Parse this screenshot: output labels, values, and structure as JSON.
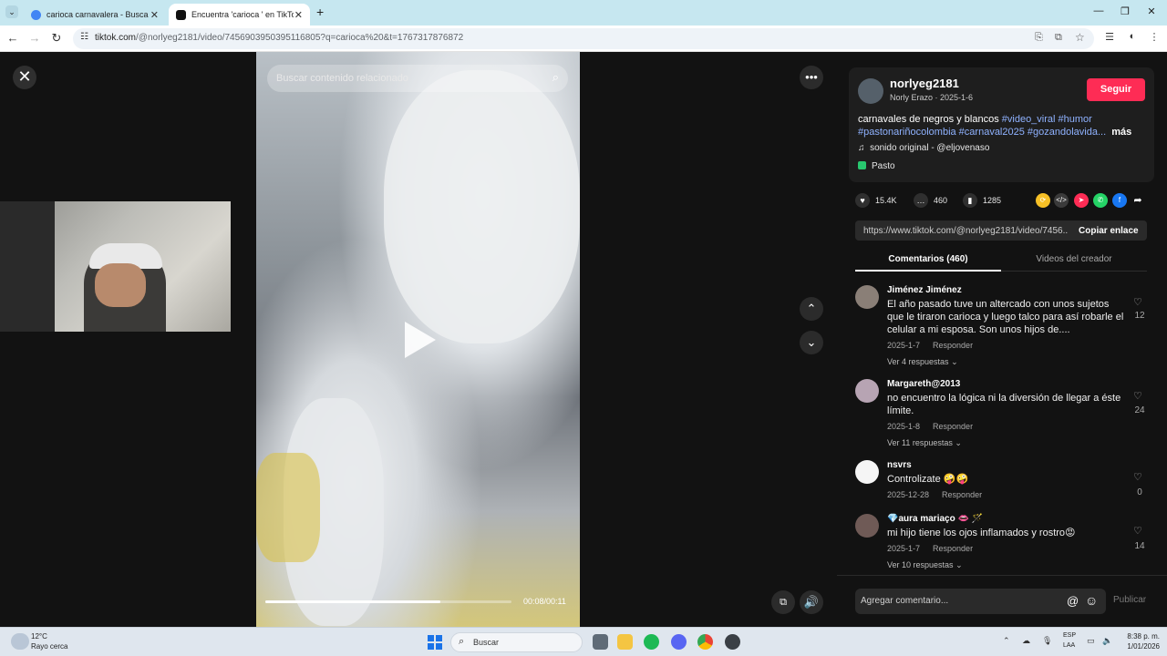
{
  "browser": {
    "tabs": [
      {
        "title": "carioca carnavalera - Buscar co",
        "favicon_color": "#4285f4"
      },
      {
        "title": "Encuentra 'carioca ' en TikTok |",
        "favicon_color": "#111111"
      }
    ],
    "new_tab_glyph": "+",
    "url_host": "tiktok.com",
    "url_path": "/@norlyeg2181/video/7456903950395116805?q=carioca%20&t=1767317876872"
  },
  "video": {
    "search_placeholder": "Buscar contenido relacionado",
    "time": "00:08/00:11",
    "progress": 0.71
  },
  "post": {
    "username": "norlyeg2181",
    "nick_date": "Norly Erazo · 2025-1-6",
    "follow_label": "Seguir",
    "caption_text": "carnavales de negros y blancos ",
    "caption_tags_1": "#video_viral #humor",
    "caption_tags_2": "#pastonariñocolombia #carnaval2025 #gozandolavida...",
    "more_label": "más",
    "music": "sonido original - @eljovenaso",
    "location": "Pasto",
    "likes": "15.4K",
    "comments_count": "460",
    "saves": "1285",
    "link": "https://www.tiktok.com/@norlyeg2181/video/7456...",
    "copy_link_label": "Copiar enlace",
    "tab_comments": "Comentarios (460)",
    "tab_creator": "Videos del creador"
  },
  "comments": [
    {
      "name": "Jiménez Jiménez",
      "text": "El año pasado tuve un altercado con unos sujetos que le tiraron carioca y luego talco para así robarle el celular a mi esposa. Son unos hijos de....",
      "date": "2025-1-7",
      "reply_label": "Responder",
      "replies": "Ver 4 respuestas",
      "likes": "12",
      "avatar_color": "#8a7f77"
    },
    {
      "name": "Margareth@2013",
      "text": "no encuentro la lógica ni la diversión de llegar a éste límite.",
      "date": "2025-1-8",
      "reply_label": "Responder",
      "replies": "Ver 11 respuestas",
      "likes": "24",
      "avatar_color": "#b7a4b3"
    },
    {
      "name": "nsvrs",
      "text": "Controlizate 🤪🤪",
      "date": "2025-12-28",
      "reply_label": "Responder",
      "replies": "",
      "likes": "0",
      "avatar_color": "#f5f5f5"
    },
    {
      "name": "💎aura mariaço 👄 🪄",
      "text": "mi hijo tiene los ojos inflamados y rostro😡",
      "date": "2025-1-7",
      "reply_label": "Responder",
      "replies": "Ver 10 respuestas",
      "likes": "14",
      "avatar_color": "#6f5a56"
    }
  ],
  "comment_box": {
    "placeholder": "Agregar comentario...",
    "publish_label": "Publicar"
  },
  "taskbar": {
    "temp": "12°C",
    "weather": "Rayo cerca",
    "search_label": "Buscar",
    "lang1": "ESP",
    "lang2": "LAA",
    "time": "8:38 p. m.",
    "date": "1/01/2026"
  },
  "colors": {
    "accent": "#fe2c55",
    "hashtag": "#8fb2ff"
  }
}
